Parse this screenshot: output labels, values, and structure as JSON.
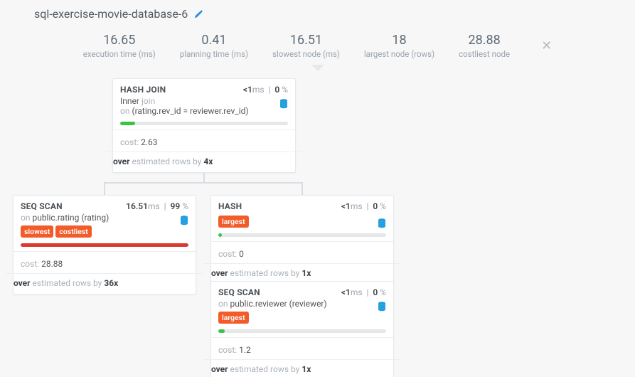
{
  "page": {
    "title": "sql-exercise-movie-database-6"
  },
  "metrics": {
    "m1_val": "16.65",
    "m1_lbl": "execution time (ms)",
    "m2_val": "0.41",
    "m2_lbl": "planning time (ms)",
    "m3_val": "16.51",
    "m3_lbl": "slowest node (ms)",
    "m4_val": "18",
    "m4_lbl": "largest node (rows)",
    "m5_val": "28.88",
    "m5_lbl": "costliest node"
  },
  "labels": {
    "inner": "Inner",
    "join_word": "join",
    "on_word": "on",
    "cost_word": "cost:",
    "over_word": "over",
    "est_phrase": "estimated rows by",
    "ms": "ms"
  },
  "nodes": {
    "hashjoin": {
      "name": "HASH JOIN",
      "time_lt": "<1",
      "time_pct": "0",
      "join_cond": "(rating.rev_id = reviewer.rev_id)",
      "cost": "2.63",
      "est_factor": "4"
    },
    "seqscan_rating": {
      "name": "SEQ SCAN",
      "time_val": "16.51",
      "time_pct": "99",
      "on_word": "on",
      "rel": "public.rating (rating)",
      "tag1": "slowest",
      "tag2": "costliest",
      "cost": "28.88",
      "est_factor": "36"
    },
    "hash": {
      "name": "HASH",
      "time_lt": "<1",
      "time_pct": "0",
      "tag1": "largest",
      "cost": "0",
      "est_factor": "1"
    },
    "seqscan_reviewer": {
      "name": "SEQ SCAN",
      "time_lt": "<1",
      "time_pct": "0",
      "on_word": "on",
      "rel": "public.reviewer (reviewer)",
      "tag1": "largest",
      "cost": "1.2",
      "est_factor": "1"
    }
  }
}
